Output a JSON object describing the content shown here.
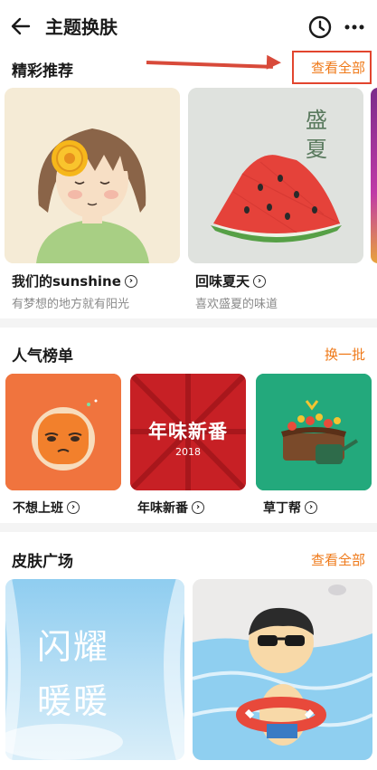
{
  "header": {
    "title": "主题换肤",
    "back_icon": "back-arrow-icon",
    "history_icon": "clock-icon",
    "more_icon": "more-dots-icon"
  },
  "featured": {
    "title": "精彩推荐",
    "view_all": "查看全部",
    "items": [
      {
        "name": "我们的sunshine",
        "desc": "有梦想的地方就有阳光"
      },
      {
        "name": "回味夏天",
        "desc": "喜欢盛夏的味道",
        "art_text": "盛夏"
      }
    ]
  },
  "popular": {
    "title": "人气榜单",
    "refresh": "换一批",
    "items": [
      {
        "name": "不想上班"
      },
      {
        "name": "年味新番",
        "art_text": "年味新番",
        "art_year": "2018"
      },
      {
        "name": "草丁帮"
      }
    ]
  },
  "plaza": {
    "title": "皮肤广场",
    "view_all": "查看全部",
    "items": [
      {
        "art_text": "闪耀暖暖"
      },
      {
        "art_text": ""
      }
    ]
  },
  "colors": {
    "accent": "#ef7a1a",
    "annotation": "#e2452e"
  }
}
